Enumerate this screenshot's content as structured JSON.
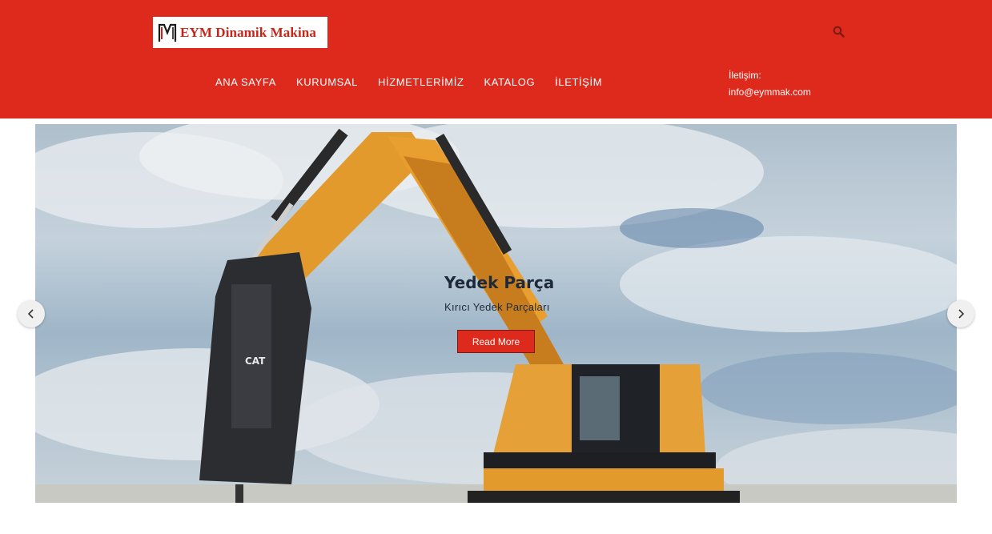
{
  "brand": {
    "logo_text": "EYM Dinamik Makina",
    "logo_color": "#c8251a"
  },
  "header": {
    "background_color": "#dd2a1d",
    "search_icon": "search-icon"
  },
  "nav": {
    "items": [
      {
        "label": "ANA SAYFA"
      },
      {
        "label": "KURUMSAL"
      },
      {
        "label": "HİZMETLERİMİZ"
      },
      {
        "label": "KATALOG"
      },
      {
        "label": "İLETİŞİM"
      }
    ]
  },
  "contact": {
    "label": "İletişim:",
    "email": "info@eymmak.com"
  },
  "slider": {
    "caption_title": "Yedek Parça",
    "caption_subtitle": "Kırıcı Yedek Parçaları",
    "button_label": "Read More",
    "prev_icon": "chevron-left-icon",
    "next_icon": "chevron-right-icon"
  }
}
